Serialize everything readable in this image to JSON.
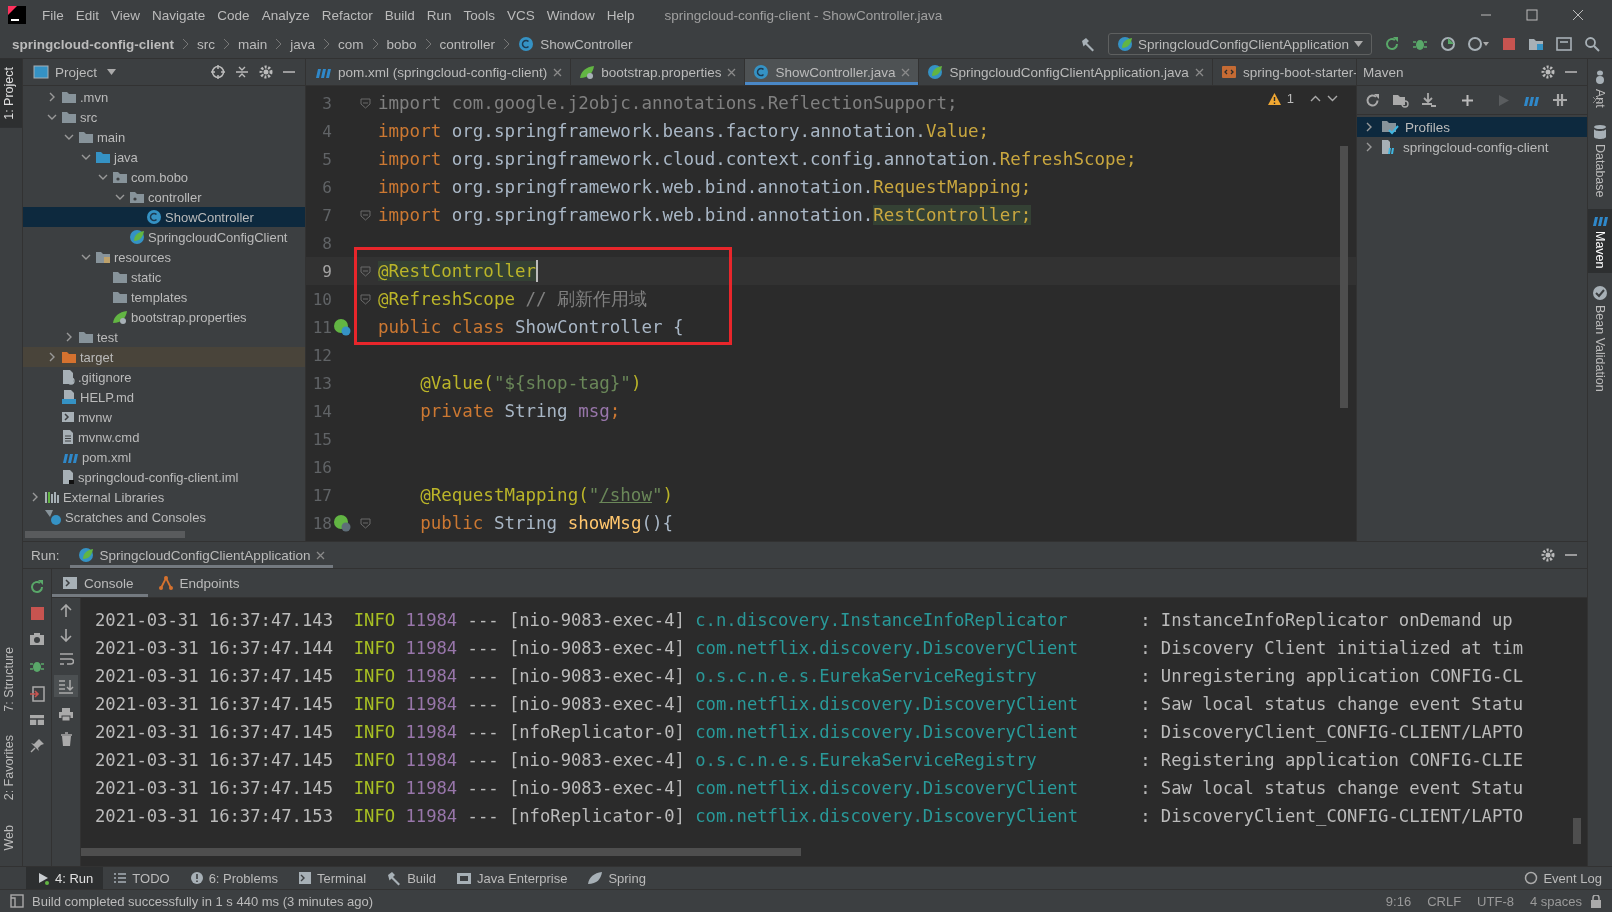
{
  "menu": [
    "File",
    "Edit",
    "View",
    "Navigate",
    "Code",
    "Analyze",
    "Refactor",
    "Build",
    "Run",
    "Tools",
    "VCS",
    "Window",
    "Help"
  ],
  "window": {
    "title": "springcloud-config-client - ShowController.java"
  },
  "breadcrumbs": [
    {
      "label": "springcloud-config-client",
      "kind": "project"
    },
    {
      "label": "src",
      "kind": "dir"
    },
    {
      "label": "main",
      "kind": "dir"
    },
    {
      "label": "java",
      "kind": "dir"
    },
    {
      "label": "com",
      "kind": "dir"
    },
    {
      "label": "bobo",
      "kind": "dir"
    },
    {
      "label": "controller",
      "kind": "dir"
    },
    {
      "label": "ShowController",
      "kind": "class"
    }
  ],
  "run_config": {
    "label": "SpringcloudConfigClientApplication"
  },
  "left_tool_tabs_top": [
    {
      "label": "1: Project",
      "selected": true
    }
  ],
  "left_tool_tabs_bottom": [
    {
      "label": "7: Structure",
      "selected": false
    },
    {
      "label": "2: Favorites",
      "selected": false
    },
    {
      "label": "Web",
      "selected": false
    }
  ],
  "project_panel": {
    "title": "Project",
    "tree": [
      {
        "children": [
          {
            "label": ".mvn",
            "kind": "folder",
            "expanded": false,
            "selected": false
          },
          {
            "label": "src",
            "kind": "folder",
            "expanded": true,
            "selected": false,
            "children": [
              {
                "label": "main",
                "kind": "folder",
                "expanded": true,
                "selected": false,
                "children": [
                  {
                    "label": "java",
                    "kind": "source-folder",
                    "expanded": true,
                    "selected": false,
                    "children": [
                      {
                        "label": "com.bobo",
                        "kind": "package",
                        "expanded": true,
                        "selected": false,
                        "children": [
                          {
                            "label": "controller",
                            "kind": "package",
                            "expanded": true,
                            "selected": false,
                            "children": [
                              {
                                "label": "ShowController",
                                "kind": "class",
                                "selected": true
                              }
                            ]
                          },
                          {
                            "label": "SpringcloudConfigClient",
                            "kind": "spring-class",
                            "selected": false
                          }
                        ]
                      }
                    ]
                  },
                  {
                    "label": "resources",
                    "kind": "resources-folder",
                    "expanded": true,
                    "selected": false,
                    "children": [
                      {
                        "label": "static",
                        "kind": "folder",
                        "selected": false
                      },
                      {
                        "label": "templates",
                        "kind": "folder",
                        "selected": false
                      },
                      {
                        "label": "bootstrap.properties",
                        "kind": "spring-properties",
                        "selected": false
                      }
                    ]
                  }
                ]
              },
              {
                "label": "test",
                "kind": "folder",
                "expanded": false,
                "selected": false
              }
            ]
          },
          {
            "label": "target",
            "kind": "excluded-folder",
            "expanded": false,
            "selected": false
          },
          {
            "label": ".gitignore",
            "kind": "ignore-file",
            "selected": false
          },
          {
            "label": "HELP.md",
            "kind": "markdown-file",
            "selected": false
          },
          {
            "label": "mvnw",
            "kind": "script-file",
            "selected": false
          },
          {
            "label": "mvnw.cmd",
            "kind": "text-file",
            "selected": false
          },
          {
            "label": "pom.xml",
            "kind": "maven",
            "selected": false
          },
          {
            "label": "springcloud-config-client.iml",
            "kind": "module-file",
            "selected": false
          }
        ]
      },
      {
        "label": "External Libraries",
        "kind": "libraries",
        "expanded": false,
        "selected": false
      },
      {
        "label": "Scratches and Consoles",
        "kind": "scratches",
        "selected": false
      }
    ]
  },
  "editor_tabs": [
    {
      "label": "pom.xml (springcloud-config-client)",
      "kind": "maven",
      "selected": false,
      "closable": true
    },
    {
      "label": "bootstrap.properties",
      "kind": "spring-properties",
      "selected": false,
      "closable": true
    },
    {
      "label": "ShowController.java",
      "kind": "class",
      "selected": true,
      "closable": true
    },
    {
      "label": "SpringcloudConfigClientApplication.java",
      "kind": "spring-class",
      "selected": false,
      "closable": true
    },
    {
      "label": "spring-boot-starter-",
      "kind": "xml-file",
      "selected": false,
      "closable": false
    }
  ],
  "editor": {
    "warnings": "1",
    "lines": [
      {
        "number": "3",
        "kind": "plain",
        "fold": true,
        "current": false,
        "segments": [
          {
            "kind": "unused",
            "text": "import com.google.j2objc.annotations.ReflectionSupport;"
          }
        ]
      },
      {
        "number": "4",
        "kind": "plain",
        "fold": false,
        "current": false,
        "segments": [
          {
            "kind": "keyword",
            "text": "import "
          },
          {
            "kind": "plain",
            "text": "org.springframework.beans.factory.annotation."
          },
          {
            "kind": "import-name",
            "text": "Value;"
          }
        ]
      },
      {
        "number": "5",
        "kind": "plain",
        "fold": false,
        "current": false,
        "segments": [
          {
            "kind": "keyword",
            "text": "import "
          },
          {
            "kind": "plain",
            "text": "org.springframework.cloud.context.config.annotation."
          },
          {
            "kind": "import-name",
            "text": "RefreshScope;"
          }
        ]
      },
      {
        "number": "6",
        "kind": "plain",
        "fold": false,
        "current": false,
        "segments": [
          {
            "kind": "keyword",
            "text": "import "
          },
          {
            "kind": "plain",
            "text": "org.springframework.web.bind.annotation."
          },
          {
            "kind": "import-name",
            "text": "RequestMapping;"
          }
        ]
      },
      {
        "number": "7",
        "kind": "plain",
        "fold": true,
        "current": false,
        "segments": [
          {
            "kind": "keyword",
            "text": "import "
          },
          {
            "kind": "plain",
            "text": "org.springframework.web.bind.annotation."
          },
          {
            "kind": "import-name-hl",
            "text": "RestController;"
          }
        ]
      },
      {
        "number": "8",
        "kind": "plain",
        "fold": false,
        "current": false
      },
      {
        "number": "9",
        "kind": "plain",
        "fold": true,
        "current": true,
        "segments": [
          {
            "kind": "annotation-hl",
            "text": "@RestController"
          }
        ]
      },
      {
        "number": "10",
        "kind": "plain",
        "fold": true,
        "current": false,
        "segments": [
          {
            "kind": "annotation",
            "text": "@RefreshScope"
          },
          {
            "kind": "comment",
            "text": " // 刷新作用域"
          }
        ]
      },
      {
        "number": "11",
        "kind": "bean-class",
        "fold": false,
        "current": false,
        "segments": [
          {
            "kind": "keyword",
            "text": "public class "
          },
          {
            "kind": "plain",
            "text": "ShowController {"
          }
        ]
      },
      {
        "number": "12",
        "kind": "plain",
        "fold": false,
        "current": false
      },
      {
        "number": "13",
        "kind": "plain",
        "fold": false,
        "current": false,
        "segments": [
          {
            "kind": "annotation",
            "text": "    @Value("
          },
          {
            "kind": "string",
            "text": "\"${shop-tag}\""
          },
          {
            "kind": "annotation",
            "text": ")"
          }
        ]
      },
      {
        "number": "14",
        "kind": "plain",
        "fold": false,
        "current": false,
        "segments": [
          {
            "kind": "keyword",
            "text": "    private "
          },
          {
            "kind": "plain",
            "text": "String "
          },
          {
            "kind": "field",
            "text": "msg"
          },
          {
            "kind": "keyword",
            "text": ";"
          }
        ]
      },
      {
        "number": "15",
        "kind": "plain",
        "fold": false,
        "current": false
      },
      {
        "number": "16",
        "kind": "plain",
        "fold": false,
        "current": false
      },
      {
        "number": "17",
        "kind": "plain",
        "fold": false,
        "current": false,
        "segments": [
          {
            "kind": "annotation",
            "text": "    @RequestMapping("
          },
          {
            "kind": "string",
            "text": "\""
          },
          {
            "kind": "link",
            "text": "/show"
          },
          {
            "kind": "string",
            "text": "\""
          },
          {
            "kind": "annotation",
            "text": ")"
          }
        ]
      },
      {
        "number": "18",
        "kind": "bean-method",
        "fold": true,
        "current": false,
        "segments": [
          {
            "kind": "keyword",
            "text": "    public "
          },
          {
            "kind": "plain",
            "text": "String "
          },
          {
            "kind": "method",
            "text": "showMsg"
          },
          {
            "kind": "plain",
            "text": "(){"
          }
        ]
      }
    ]
  },
  "maven_panel": {
    "title": "Maven",
    "tree": [
      {
        "label": "Profiles",
        "kind": "profiles",
        "expanded": false,
        "selected": true
      },
      {
        "label": "springcloud-config-client",
        "kind": "maven-module",
        "expanded": false,
        "selected": false
      }
    ]
  },
  "right_tool_tabs": [
    {
      "label": "Ant",
      "kind": "ant",
      "selected": false
    },
    {
      "label": "Database",
      "kind": "database",
      "selected": false
    },
    {
      "label": "Maven",
      "kind": "maven",
      "selected": true
    },
    {
      "label": "Bean Validation",
      "kind": "bean-validation",
      "selected": false
    }
  ],
  "run_panel": {
    "label": "Run:",
    "tab": {
      "label": "SpringcloudConfigClientApplication"
    },
    "subtabs": [
      {
        "label": "Console",
        "kind": "console",
        "selected": true
      },
      {
        "label": "Endpoints",
        "kind": "endpoints",
        "selected": false
      }
    ],
    "log": [
      {
        "time": "2021-03-31 16:37:47.143",
        "level": "INFO",
        "pid": "11984",
        "dashes": "---",
        "thread": "[nio-9083-exec-4]",
        "logger": "c.n.discovery.InstanceInfoReplicator",
        "message": ": InstanceInfoReplicator onDemand up"
      },
      {
        "time": "2021-03-31 16:37:47.144",
        "level": "INFO",
        "pid": "11984",
        "dashes": "---",
        "thread": "[nio-9083-exec-4]",
        "logger": "com.netflix.discovery.DiscoveryClient",
        "message": ": Discovery Client initialized at tim"
      },
      {
        "time": "2021-03-31 16:37:47.145",
        "level": "INFO",
        "pid": "11984",
        "dashes": "---",
        "thread": "[nio-9083-exec-4]",
        "logger": "o.s.c.n.e.s.EurekaServiceRegistry",
        "message": ": Unregistering application CONFIG-CL"
      },
      {
        "time": "2021-03-31 16:37:47.145",
        "level": "INFO",
        "pid": "11984",
        "dashes": "---",
        "thread": "[nio-9083-exec-4]",
        "logger": "com.netflix.discovery.DiscoveryClient",
        "message": ": Saw local status change event Statu"
      },
      {
        "time": "2021-03-31 16:37:47.145",
        "level": "INFO",
        "pid": "11984",
        "dashes": "---",
        "thread": "[nfoReplicator-0]",
        "logger": "com.netflix.discovery.DiscoveryClient",
        "message": ": DiscoveryClient_CONFIG-CLIENT/LAPTO"
      },
      {
        "time": "2021-03-31 16:37:47.145",
        "level": "INFO",
        "pid": "11984",
        "dashes": "---",
        "thread": "[nio-9083-exec-4]",
        "logger": "o.s.c.n.e.s.EurekaServiceRegistry",
        "message": ": Registering application CONFIG-CLIE"
      },
      {
        "time": "2021-03-31 16:37:47.145",
        "level": "INFO",
        "pid": "11984",
        "dashes": "---",
        "thread": "[nio-9083-exec-4]",
        "logger": "com.netflix.discovery.DiscoveryClient",
        "message": ": Saw local status change event Statu"
      },
      {
        "time": "2021-03-31 16:37:47.153",
        "level": "INFO",
        "pid": "11984",
        "dashes": "---",
        "thread": "[nfoReplicator-0]",
        "logger": "com.netflix.discovery.DiscoveryClient",
        "message": ": DiscoveryClient_CONFIG-CLIENT/LAPTO"
      }
    ]
  },
  "bottom_tool_tabs": [
    {
      "label": "4: Run",
      "kind": "run",
      "selected": true
    },
    {
      "label": "TODO",
      "kind": "todo",
      "selected": false
    },
    {
      "label": "6: Problems",
      "kind": "problems",
      "selected": false
    },
    {
      "label": "Terminal",
      "kind": "terminal",
      "selected": false
    },
    {
      "label": "Build",
      "kind": "hammer",
      "selected": false
    },
    {
      "label": "Java Enterprise",
      "kind": "enterprise",
      "selected": false
    },
    {
      "label": "Spring",
      "kind": "spring",
      "selected": false
    }
  ],
  "event_log": "Event Log",
  "status_bar": {
    "message": "Build completed successfully in 1 s 440 ms (3 minutes ago)",
    "items": [
      "9:16",
      "CRLF",
      "UTF-8",
      "4 spaces"
    ]
  }
}
